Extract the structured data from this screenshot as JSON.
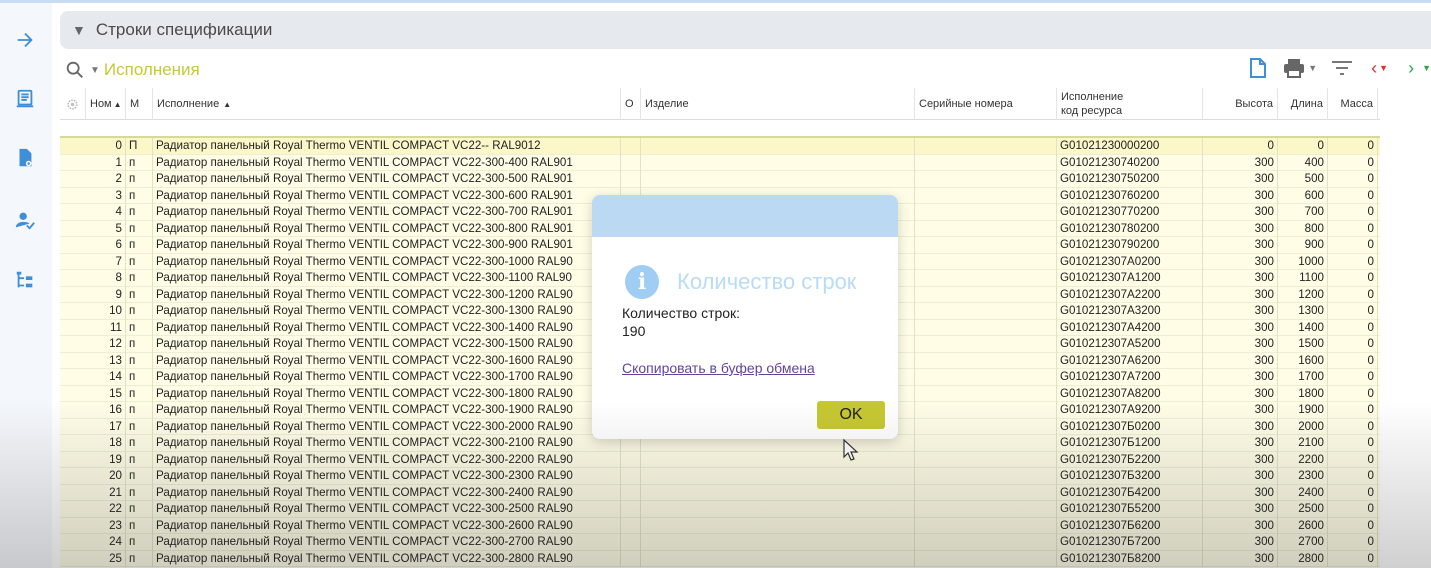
{
  "section": {
    "title": "Строки спецификации"
  },
  "toolbar": {
    "view_name": "Исполнения"
  },
  "columns": {
    "num": "Ном",
    "m": "М",
    "variant": "Исполнение",
    "o": "О",
    "product": "Изделие",
    "serials": "Серийные номера",
    "code_line1": "Исполнение",
    "code_line2": "код ресурса",
    "height": "Высота",
    "length": "Длина",
    "mass": "Масса"
  },
  "rows": [
    {
      "num": "0",
      "m": "П",
      "name": "Радиатор панельный Royal Thermo VENTIL COMPACT VC22-- RAL9012",
      "code": "G01021230000200",
      "h": "0",
      "l": "0",
      "mass": "0"
    },
    {
      "num": "1",
      "m": "п",
      "name": "Радиатор панельный Royal Thermo VENTIL COMPACT VC22-300-400 RAL901",
      "code": "G01021230740200",
      "h": "300",
      "l": "400",
      "mass": "0"
    },
    {
      "num": "2",
      "m": "п",
      "name": "Радиатор панельный Royal Thermo VENTIL COMPACT VC22-300-500 RAL901",
      "code": "G01021230750200",
      "h": "300",
      "l": "500",
      "mass": "0"
    },
    {
      "num": "3",
      "m": "п",
      "name": "Радиатор панельный Royal Thermo VENTIL COMPACT VC22-300-600 RAL901",
      "code": "G01021230760200",
      "h": "300",
      "l": "600",
      "mass": "0"
    },
    {
      "num": "4",
      "m": "п",
      "name": "Радиатор панельный Royal Thermo VENTIL COMPACT VC22-300-700 RAL901",
      "code": "G01021230770200",
      "h": "300",
      "l": "700",
      "mass": "0"
    },
    {
      "num": "5",
      "m": "п",
      "name": "Радиатор панельный Royal Thermo VENTIL COMPACT VC22-300-800 RAL901",
      "code": "G01021230780200",
      "h": "300",
      "l": "800",
      "mass": "0"
    },
    {
      "num": "6",
      "m": "п",
      "name": "Радиатор панельный Royal Thermo VENTIL COMPACT VC22-300-900 RAL901",
      "code": "G01021230790200",
      "h": "300",
      "l": "900",
      "mass": "0"
    },
    {
      "num": "7",
      "m": "п",
      "name": "Радиатор панельный Royal Thermo VENTIL COMPACT VC22-300-1000 RAL90",
      "code": "G010212307A0200",
      "h": "300",
      "l": "1000",
      "mass": "0"
    },
    {
      "num": "8",
      "m": "п",
      "name": "Радиатор панельный Royal Thermo VENTIL COMPACT VC22-300-1100 RAL90",
      "code": "G010212307A1200",
      "h": "300",
      "l": "1100",
      "mass": "0"
    },
    {
      "num": "9",
      "m": "п",
      "name": "Радиатор панельный Royal Thermo VENTIL COMPACT VC22-300-1200 RAL90",
      "code": "G010212307A2200",
      "h": "300",
      "l": "1200",
      "mass": "0"
    },
    {
      "num": "10",
      "m": "п",
      "name": "Радиатор панельный Royal Thermo VENTIL COMPACT VC22-300-1300 RAL90",
      "code": "G010212307A3200",
      "h": "300",
      "l": "1300",
      "mass": "0"
    },
    {
      "num": "11",
      "m": "п",
      "name": "Радиатор панельный Royal Thermo VENTIL COMPACT VC22-300-1400 RAL90",
      "code": "G010212307A4200",
      "h": "300",
      "l": "1400",
      "mass": "0"
    },
    {
      "num": "12",
      "m": "п",
      "name": "Радиатор панельный Royal Thermo VENTIL COMPACT VC22-300-1500 RAL90",
      "code": "G010212307A5200",
      "h": "300",
      "l": "1500",
      "mass": "0"
    },
    {
      "num": "13",
      "m": "п",
      "name": "Радиатор панельный Royal Thermo VENTIL COMPACT VC22-300-1600 RAL90",
      "code": "G010212307A6200",
      "h": "300",
      "l": "1600",
      "mass": "0"
    },
    {
      "num": "14",
      "m": "п",
      "name": "Радиатор панельный Royal Thermo VENTIL COMPACT VC22-300-1700 RAL90",
      "code": "G010212307A7200",
      "h": "300",
      "l": "1700",
      "mass": "0"
    },
    {
      "num": "15",
      "m": "п",
      "name": "Радиатор панельный Royal Thermo VENTIL COMPACT VC22-300-1800 RAL90",
      "code": "G010212307A8200",
      "h": "300",
      "l": "1800",
      "mass": "0"
    },
    {
      "num": "16",
      "m": "п",
      "name": "Радиатор панельный Royal Thermo VENTIL COMPACT VC22-300-1900 RAL90",
      "code": "G010212307A9200",
      "h": "300",
      "l": "1900",
      "mass": "0"
    },
    {
      "num": "17",
      "m": "п",
      "name": "Радиатор панельный Royal Thermo VENTIL COMPACT VC22-300-2000 RAL90",
      "code": "G010212307Б0200",
      "h": "300",
      "l": "2000",
      "mass": "0"
    },
    {
      "num": "18",
      "m": "п",
      "name": "Радиатор панельный Royal Thermo VENTIL COMPACT VC22-300-2100 RAL90",
      "code": "G010212307Б1200",
      "h": "300",
      "l": "2100",
      "mass": "0"
    },
    {
      "num": "19",
      "m": "п",
      "name": "Радиатор панельный Royal Thermo VENTIL COMPACT VC22-300-2200 RAL90",
      "code": "G010212307Б2200",
      "h": "300",
      "l": "2200",
      "mass": "0"
    },
    {
      "num": "20",
      "m": "п",
      "name": "Радиатор панельный Royal Thermo VENTIL COMPACT VC22-300-2300 RAL90",
      "code": "G010212307Б3200",
      "h": "300",
      "l": "2300",
      "mass": "0"
    },
    {
      "num": "21",
      "m": "п",
      "name": "Радиатор панельный Royal Thermo VENTIL COMPACT VC22-300-2400 RAL90",
      "code": "G010212307Б4200",
      "h": "300",
      "l": "2400",
      "mass": "0"
    },
    {
      "num": "22",
      "m": "п",
      "name": "Радиатор панельный Royal Thermo VENTIL COMPACT VC22-300-2500 RAL90",
      "code": "G010212307Б5200",
      "h": "300",
      "l": "2500",
      "mass": "0"
    },
    {
      "num": "23",
      "m": "п",
      "name": "Радиатор панельный Royal Thermo VENTIL COMPACT VC22-300-2600 RAL90",
      "code": "G010212307Б6200",
      "h": "300",
      "l": "2600",
      "mass": "0"
    },
    {
      "num": "24",
      "m": "п",
      "name": "Радиатор панельный Royal Thermo VENTIL COMPACT VC22-300-2700 RAL90",
      "code": "G010212307Б7200",
      "h": "300",
      "l": "2700",
      "mass": "0"
    },
    {
      "num": "25",
      "m": "п",
      "name": "Радиатор панельный Royal Thermo VENTIL COMPACT VC22-300-2800 RAL90",
      "code": "G010212307Б8200",
      "h": "300",
      "l": "2800",
      "mass": "0"
    }
  ],
  "dialog": {
    "title": "Количество строк",
    "label": "Количество строк:",
    "value": "190",
    "copy_link": "Скопировать в буфер обмена",
    "ok": "OK"
  },
  "colors": {
    "accent": "#3f8fd8",
    "view_name": "#c3c93a",
    "ok_button": "#c6c831",
    "row_bg": "#fffde6"
  }
}
